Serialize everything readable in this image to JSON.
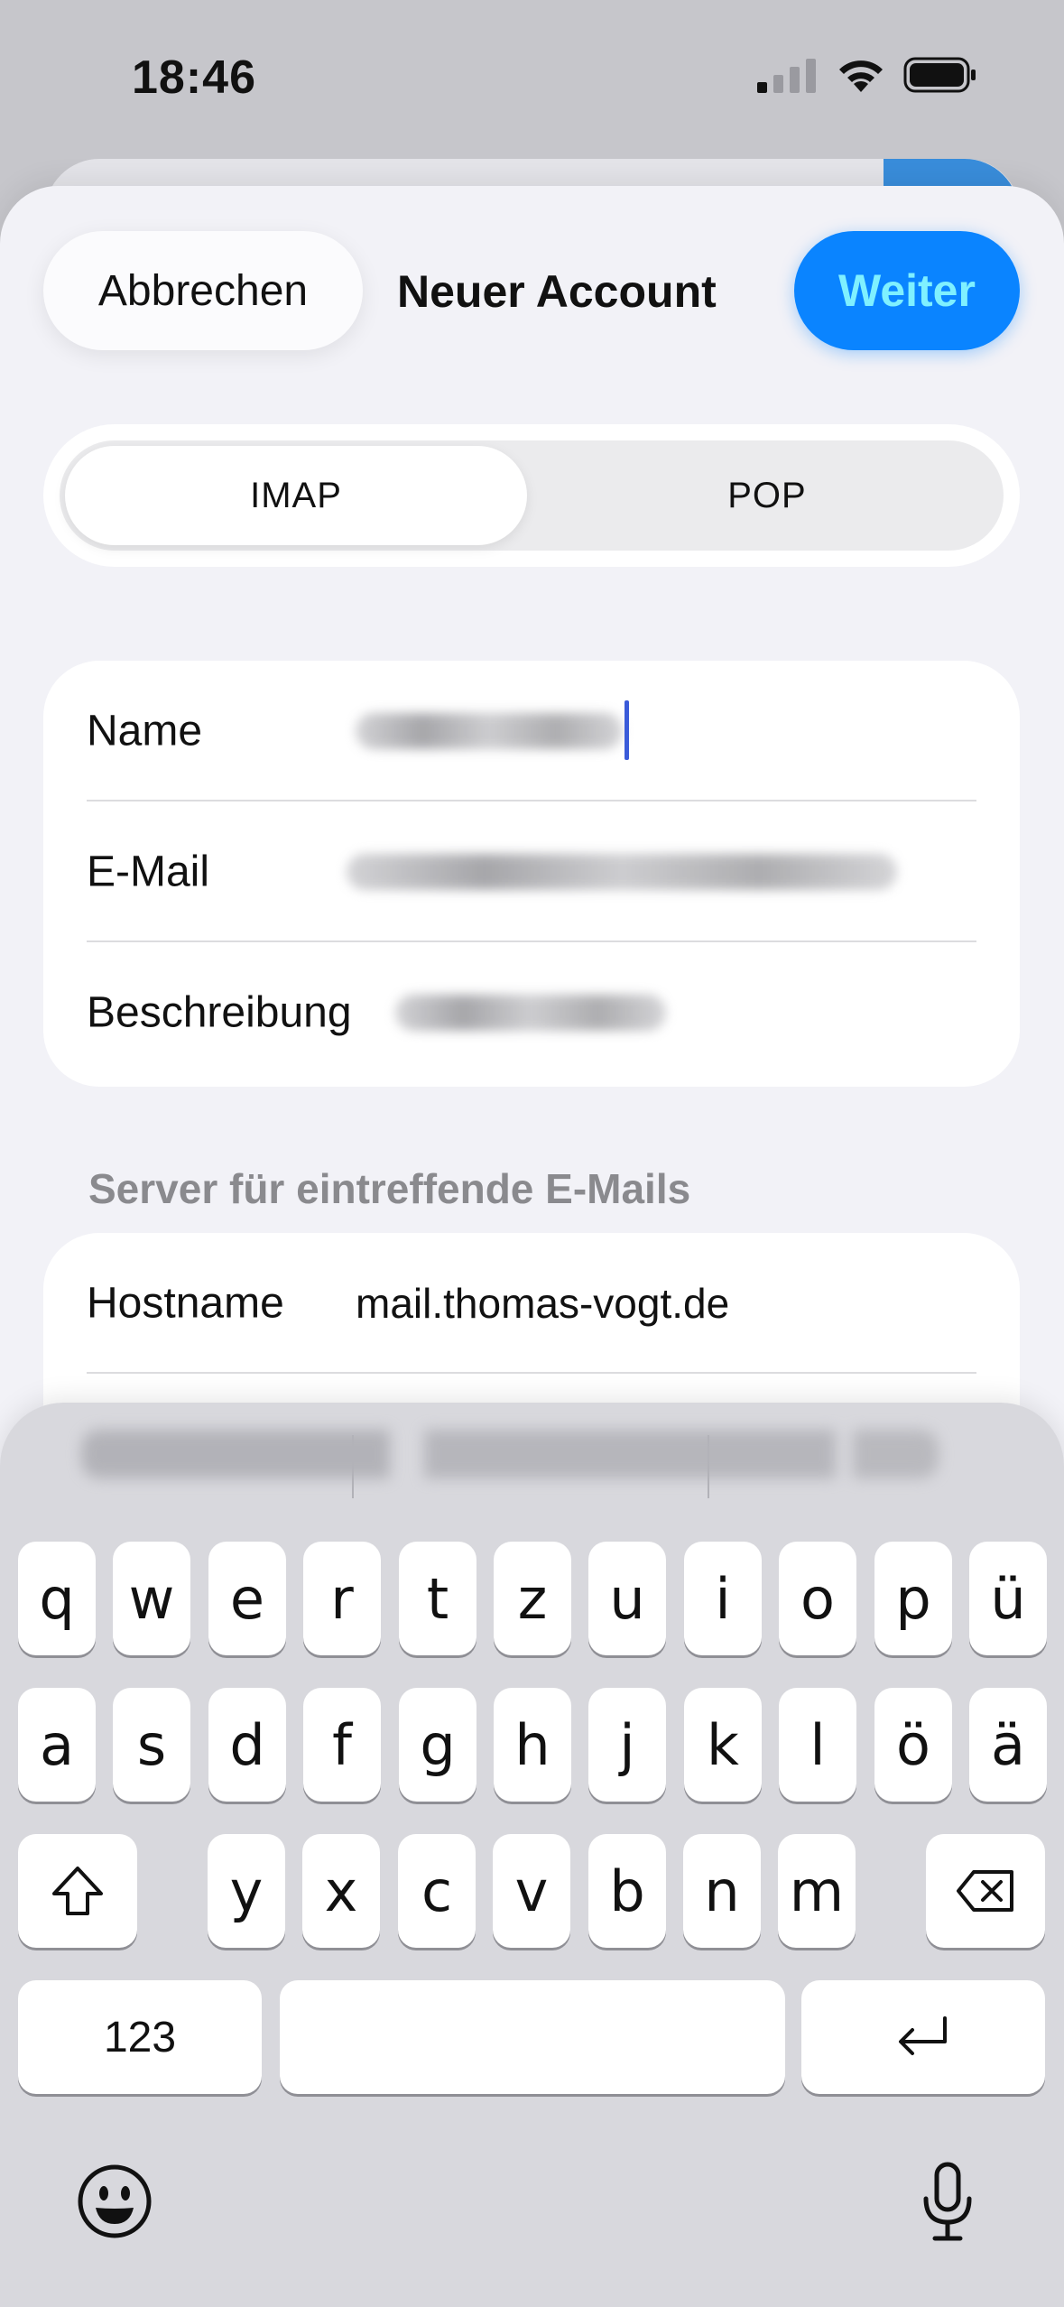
{
  "status_bar": {
    "time": "18:46"
  },
  "sheet": {
    "cancel_label": "Abbrechen",
    "title": "Neuer Account",
    "next_label": "Weiter",
    "accent": "#0a84ff"
  },
  "segmented": {
    "options": [
      "IMAP",
      "POP"
    ],
    "selected": "IMAP"
  },
  "account": {
    "name_label": "Name",
    "email_label": "E-Mail",
    "description_label": "Beschreibung"
  },
  "incoming": {
    "header": "Server für eintreffende E-Mails",
    "hostname_label": "Hostname",
    "hostname_value": "mail.thomas-vogt.de"
  },
  "keyboard": {
    "row1": [
      "q",
      "w",
      "e",
      "r",
      "t",
      "z",
      "u",
      "i",
      "o",
      "p",
      "ü"
    ],
    "row2": [
      "a",
      "s",
      "d",
      "f",
      "g",
      "h",
      "j",
      "k",
      "l",
      "ö",
      "ä"
    ],
    "row3": [
      "y",
      "x",
      "c",
      "v",
      "b",
      "n",
      "m"
    ],
    "numbers_label": "123",
    "icons": [
      "shift-icon",
      "backspace-icon",
      "return-icon",
      "emoji-icon",
      "microphone-icon"
    ]
  }
}
